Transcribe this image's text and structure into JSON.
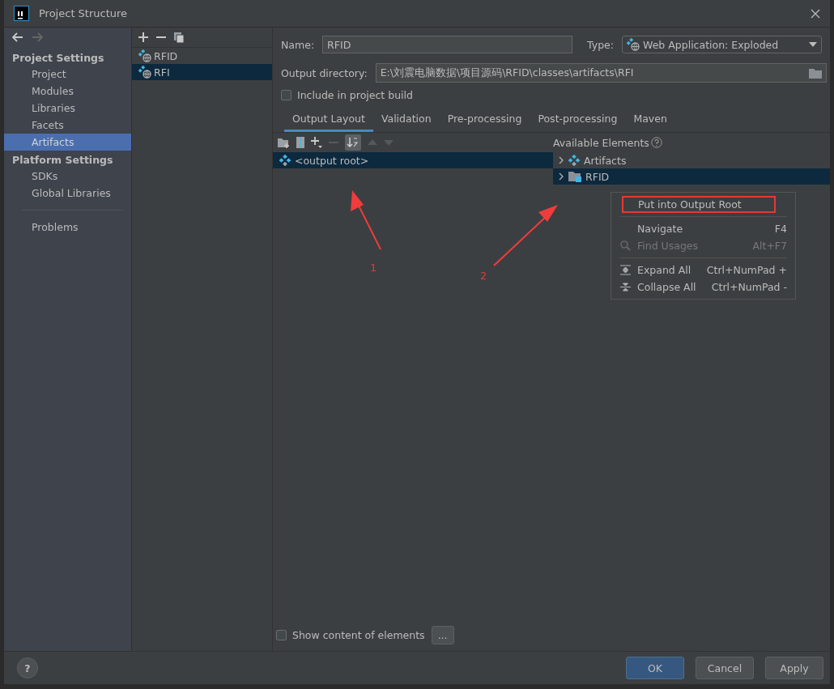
{
  "window": {
    "title": "Project Structure"
  },
  "sidebar": {
    "sections": [
      {
        "title": "Project Settings",
        "items": [
          {
            "label": "Project",
            "selected": false
          },
          {
            "label": "Modules",
            "selected": false
          },
          {
            "label": "Libraries",
            "selected": false
          },
          {
            "label": "Facets",
            "selected": false
          },
          {
            "label": "Artifacts",
            "selected": true
          }
        ]
      },
      {
        "title": "Platform Settings",
        "items": [
          {
            "label": "SDKs",
            "selected": false
          },
          {
            "label": "Global Libraries",
            "selected": false
          }
        ]
      }
    ],
    "extra_items": [
      {
        "label": "Problems",
        "selected": false
      }
    ]
  },
  "artifacts": [
    {
      "name": "RFID",
      "selected": false
    },
    {
      "name": "RFI",
      "selected": true
    }
  ],
  "form": {
    "name_label": "Name:",
    "name_value": "RFID",
    "type_label": "Type:",
    "type_value": "Web Application: Exploded",
    "output_label": "Output directory:",
    "output_value": "E:\\刘震电脑数据\\项目源码\\RFID\\classes\\artifacts\\RFI",
    "include_label": "Include in project build",
    "include_checked": false
  },
  "tabs": [
    {
      "label": "Output Layout",
      "selected": true
    },
    {
      "label": "Validation",
      "selected": false
    },
    {
      "label": "Pre-processing",
      "selected": false
    },
    {
      "label": "Post-processing",
      "selected": false
    },
    {
      "label": "Maven",
      "selected": false
    }
  ],
  "layout_tree": [
    {
      "label": "<output root>",
      "selected": true
    }
  ],
  "available": {
    "title": "Available Elements",
    "items": [
      {
        "label": "Artifacts",
        "kind": "artifact",
        "selected": false
      },
      {
        "label": "RFID",
        "kind": "module",
        "selected": true
      }
    ]
  },
  "context_menu": {
    "groups": [
      [
        {
          "label": "Put into Output Root",
          "kind": "plain",
          "disabled": false,
          "marked": true
        }
      ],
      [
        {
          "label": "Navigate",
          "shortcut": "F4",
          "kind": "plain",
          "disabled": false,
          "marked": false
        },
        {
          "label": "Find Usages",
          "shortcut": "Alt+F7",
          "kind": "find",
          "disabled": true,
          "marked": false
        }
      ],
      [
        {
          "label": "Expand All",
          "shortcut": "Ctrl+NumPad +",
          "kind": "expand",
          "disabled": false,
          "marked": false
        },
        {
          "label": "Collapse All",
          "shortcut": "Ctrl+NumPad -",
          "kind": "collapse",
          "disabled": false,
          "marked": false
        }
      ]
    ]
  },
  "annotations": [
    {
      "label": "1"
    },
    {
      "label": "2"
    }
  ],
  "footer": {
    "show_content_label": "Show content of elements",
    "show_content_checked": false,
    "more_button": "...",
    "help": "?",
    "buttons": [
      {
        "label": "OK",
        "default": true
      },
      {
        "label": "Cancel",
        "default": false
      },
      {
        "label": "Apply",
        "default": false
      }
    ]
  }
}
